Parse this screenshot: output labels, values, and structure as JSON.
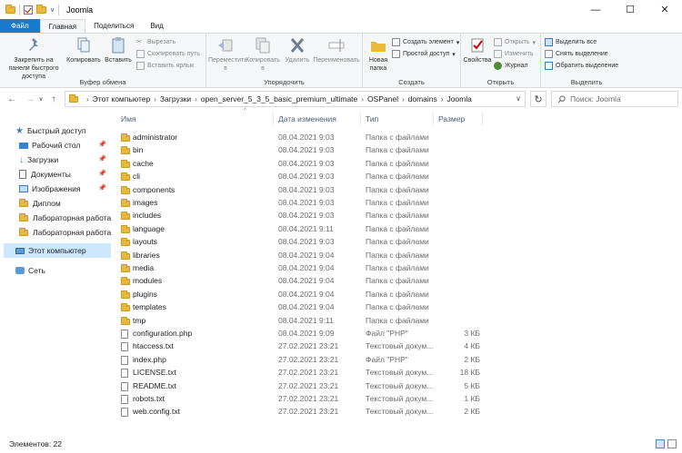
{
  "window": {
    "title": "Joomla",
    "minimize_glyph": "—",
    "maximize_glyph": "☐",
    "close_glyph": "✕",
    "qa_dropdown_glyph": "∨"
  },
  "ribbon_tabs": {
    "file": "Файл",
    "home": "Главная",
    "share": "Поделиться",
    "view": "Вид"
  },
  "ribbon": {
    "clipboard": {
      "label": "Буфер обмена",
      "pin": "Закрепить на панели быстрого доступа",
      "copy": "Копировать",
      "paste": "Вставить",
      "cut": "Вырезать",
      "copy_path": "Скопировать путь",
      "paste_shortcut": "Вставить ярлык"
    },
    "organize": {
      "label": "Упорядочить",
      "move_to": "Переместить в",
      "copy_to": "Копировать в",
      "delete": "Удалить",
      "rename": "Переименовать"
    },
    "create": {
      "label": "Создать",
      "new_folder": "Новая папка",
      "new_item": "Создать элемент",
      "easy_access": "Простой доступ"
    },
    "open": {
      "label": "Открыть",
      "properties": "Свойства",
      "open": "Открыть",
      "edit": "Изменить",
      "history": "Журнал"
    },
    "select": {
      "label": "Выделить",
      "select_all": "Выделить все",
      "select_none": "Снять выделение",
      "invert": "Обратить выделение"
    }
  },
  "nav_buttons": {
    "back": "←",
    "forward": "→",
    "recent": "∨",
    "up": "↑"
  },
  "address": {
    "crumbs": [
      "Этот компьютер",
      "Загрузки",
      "open_server_5_3_5_basic_premium_ultimate",
      "OSPanel",
      "domains",
      "Joomla"
    ],
    "separator": "›",
    "dropdown_glyph": "∨",
    "refresh_glyph": "↻"
  },
  "search": {
    "placeholder": "Поиск: Joomla",
    "icon": "search-icon"
  },
  "nav_pane": {
    "quick_access": "Быстрый доступ",
    "pin_glyph": "📌",
    "items": [
      "Рабочий стол",
      "Загрузки",
      "Документы",
      "Изображения",
      "Диплом",
      "Лабораторная работа",
      "Лабораторная работа"
    ],
    "this_pc": "Этот компьютер",
    "network": "Сеть"
  },
  "columns": {
    "name": "Имя",
    "date": "Дата изменения",
    "type": "Тип",
    "size": "Размер",
    "sort_glyph": "^"
  },
  "files": [
    {
      "name": "administrator",
      "date": "08.04.2021 9:03",
      "type": "Папка с файлами",
      "size": "",
      "kind": "folder"
    },
    {
      "name": "bin",
      "date": "08.04.2021 9:03",
      "type": "Папка с файлами",
      "size": "",
      "kind": "folder"
    },
    {
      "name": "cache",
      "date": "08.04.2021 9:03",
      "type": "Папка с файлами",
      "size": "",
      "kind": "folder"
    },
    {
      "name": "cli",
      "date": "08.04.2021 9:03",
      "type": "Папка с файлами",
      "size": "",
      "kind": "folder"
    },
    {
      "name": "components",
      "date": "08.04.2021 9:03",
      "type": "Папка с файлами",
      "size": "",
      "kind": "folder"
    },
    {
      "name": "images",
      "date": "08.04.2021 9:03",
      "type": "Папка с файлами",
      "size": "",
      "kind": "folder"
    },
    {
      "name": "includes",
      "date": "08.04.2021 9:03",
      "type": "Папка с файлами",
      "size": "",
      "kind": "folder"
    },
    {
      "name": "language",
      "date": "08.04.2021 9:11",
      "type": "Папка с файлами",
      "size": "",
      "kind": "folder"
    },
    {
      "name": "layouts",
      "date": "08.04.2021 9:03",
      "type": "Папка с файлами",
      "size": "",
      "kind": "folder"
    },
    {
      "name": "libraries",
      "date": "08.04.2021 9:04",
      "type": "Папка с файлами",
      "size": "",
      "kind": "folder"
    },
    {
      "name": "media",
      "date": "08.04.2021 9:04",
      "type": "Папка с файлами",
      "size": "",
      "kind": "folder"
    },
    {
      "name": "modules",
      "date": "08.04.2021 9:04",
      "type": "Папка с файлами",
      "size": "",
      "kind": "folder"
    },
    {
      "name": "plugins",
      "date": "08.04.2021 9:04",
      "type": "Папка с файлами",
      "size": "",
      "kind": "folder"
    },
    {
      "name": "templates",
      "date": "08.04.2021 9:04",
      "type": "Папка с файлами",
      "size": "",
      "kind": "folder"
    },
    {
      "name": "tmp",
      "date": "08.04.2021 9:11",
      "type": "Папка с файлами",
      "size": "",
      "kind": "folder"
    },
    {
      "name": "configuration.php",
      "date": "08.04.2021 9:09",
      "type": "Файл \"PHP\"",
      "size": "3 КБ",
      "kind": "file"
    },
    {
      "name": "htaccess.txt",
      "date": "27.02.2021 23:21",
      "type": "Текстовый докум...",
      "size": "4 КБ",
      "kind": "file"
    },
    {
      "name": "index.php",
      "date": "27.02.2021 23:21",
      "type": "Файл \"PHP\"",
      "size": "2 КБ",
      "kind": "file"
    },
    {
      "name": "LICENSE.txt",
      "date": "27.02.2021 23:21",
      "type": "Текстовый докум...",
      "size": "18 КБ",
      "kind": "file"
    },
    {
      "name": "README.txt",
      "date": "27.02.2021 23:21",
      "type": "Текстовый докум...",
      "size": "5 КБ",
      "kind": "file"
    },
    {
      "name": "robots.txt",
      "date": "27.02.2021 23:21",
      "type": "Текстовый докум...",
      "size": "1 КБ",
      "kind": "file"
    },
    {
      "name": "web.config.txt",
      "date": "27.02.2021 23:21",
      "type": "Текстовый докум...",
      "size": "2 КБ",
      "kind": "file"
    }
  ],
  "status": {
    "items_count": "Элементов: 22"
  },
  "colors": {
    "accent": "#1979ca",
    "selection": "#cce8ff",
    "folder": "#e8b93a"
  }
}
